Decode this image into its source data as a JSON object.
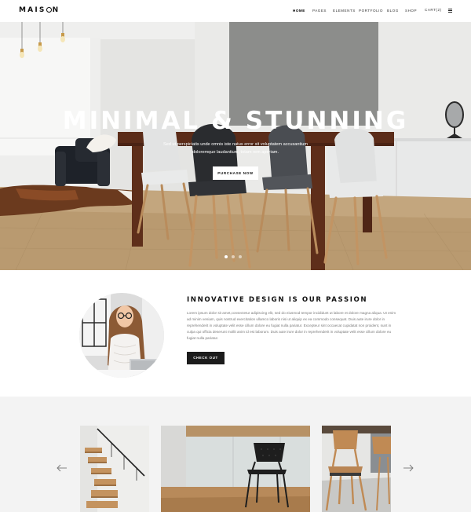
{
  "header": {
    "logo": {
      "left": "MAIS",
      "right": "N",
      "icon": "ring-o-icon"
    },
    "nav": [
      {
        "label": "HOME",
        "active": true
      },
      {
        "label": "PAGES",
        "active": false
      },
      {
        "label": "ELEMENTS",
        "active": false
      },
      {
        "label": "PORTFOLIO",
        "active": false
      },
      {
        "label": "BLOG",
        "active": false
      },
      {
        "label": "SHOP",
        "active": false
      },
      {
        "label": "CART(2)",
        "active": false
      }
    ],
    "menu_icon": "hamburger-icon"
  },
  "hero": {
    "title": "MINIMAL & STUNNING",
    "subtitle": "Sed ut perspiciatis unde omnis iste natus error sit voluptatem accusantium doloremque laudantium, totam rem aperiam.",
    "button": "PURCHASE NOW",
    "slides_total": 3,
    "slide_active": 1
  },
  "about": {
    "title": "INNOVATIVE DESIGN IS OUR PASSION",
    "body": "Lorem ipsum dolor sit amet,consectetur adipiscing elit, sed do eiusmod tempor incididunt ut labore et dolore magna aliqua. Ut enim ad minim veniam, quis nostrud exercitation ullamco laboris nisi ut aliquip ex ea commodo consequat. Duis aute irure dolor in reprehenderit in voluptate velit esse cillum dolore eu fugiat nulla pariatur. Excepteur sint occaecat cupidatat non proident, sunt in culpa qui officia deserunt mollit anim id est laborum. Duis aute irure dolor in reprehenderit in voluptate velit esse cillum dolore eu fugiat nulla pariatur.",
    "button": "CHECK OUT"
  },
  "gallery": {
    "prev_icon": "arrow-left-icon",
    "next_icon": "arrow-right-icon",
    "items": [
      "wooden-staircase",
      "black-chair-glass-railing",
      "wooden-chair"
    ]
  },
  "colors": {
    "accent_dark": "#1c1c1c",
    "hero_text": "#ffffff",
    "gallery_bg": "#f3f3f3",
    "body_text": "#7a7a7a"
  }
}
